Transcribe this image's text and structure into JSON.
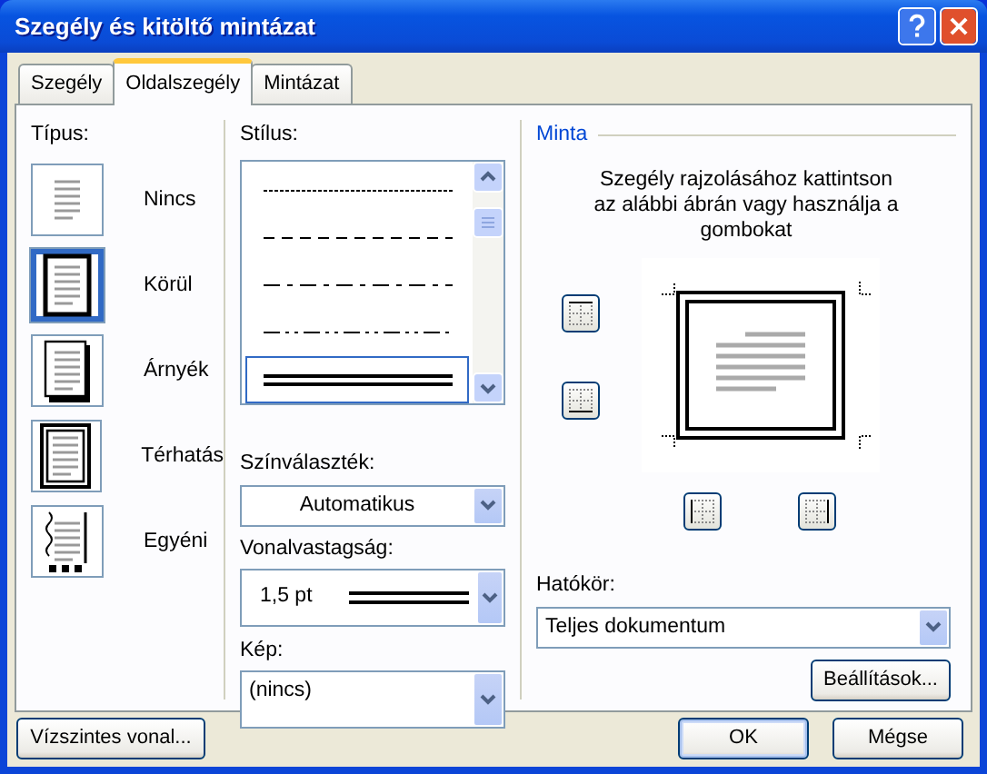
{
  "window": {
    "title": "Szegély és kitöltő mintázat"
  },
  "tabs": [
    {
      "label": "Szegély",
      "selected": false
    },
    {
      "label": "Oldalszegély",
      "selected": true
    },
    {
      "label": "Mintázat",
      "selected": false
    }
  ],
  "type": {
    "label": "Típus:",
    "items": [
      {
        "label": "Nincs",
        "kind": "none",
        "selected": false
      },
      {
        "label": "Körül",
        "kind": "box",
        "selected": true
      },
      {
        "label": "Árnyék",
        "kind": "shadow",
        "selected": false
      },
      {
        "label": "Térhatás",
        "kind": "threed",
        "selected": false
      },
      {
        "label": "Egyéni",
        "kind": "custom",
        "selected": false
      }
    ]
  },
  "style": {
    "label": "Stílus:",
    "items": [
      {
        "kind": "dotted",
        "selected": false
      },
      {
        "kind": "dashed",
        "selected": false
      },
      {
        "kind": "dashdot",
        "selected": false
      },
      {
        "kind": "dashdotdot",
        "selected": false
      },
      {
        "kind": "double",
        "selected": true
      }
    ]
  },
  "color": {
    "label": "Színválaszték:",
    "value": "Automatikus"
  },
  "width": {
    "label": "Vonalvastagság:",
    "value": "1,5 pt"
  },
  "art": {
    "label": "Kép:",
    "value": "(nincs)"
  },
  "preview": {
    "title": "Minta",
    "hint": "Szegély rajzolásához kattintson az alábbi ábrán vagy használja a gombokat"
  },
  "apply_to": {
    "label": "Hatókör:",
    "value": "Teljes dokumentum"
  },
  "options_button": "Beállítások...",
  "horizontal_line_button": "Vízszintes vonal...",
  "ok_button": "OK",
  "cancel_button": "Mégse"
}
